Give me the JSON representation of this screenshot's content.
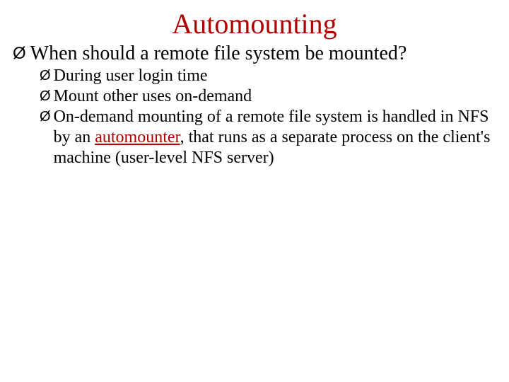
{
  "title": "Automounting",
  "main_bullet": {
    "marker": "Ø",
    "text": "When should a remote file system be mounted?"
  },
  "sub_bullets": {
    "marker": "Ø",
    "item1": "During user login time",
    "item2": "Mount other uses on-demand",
    "item3_part1": "On-demand mounting of a remote file system is handled in NFS by an ",
    "item3_special": "automounter",
    "item3_part2": ", that runs as a separate process on the client's machine (user-level NFS server)"
  }
}
